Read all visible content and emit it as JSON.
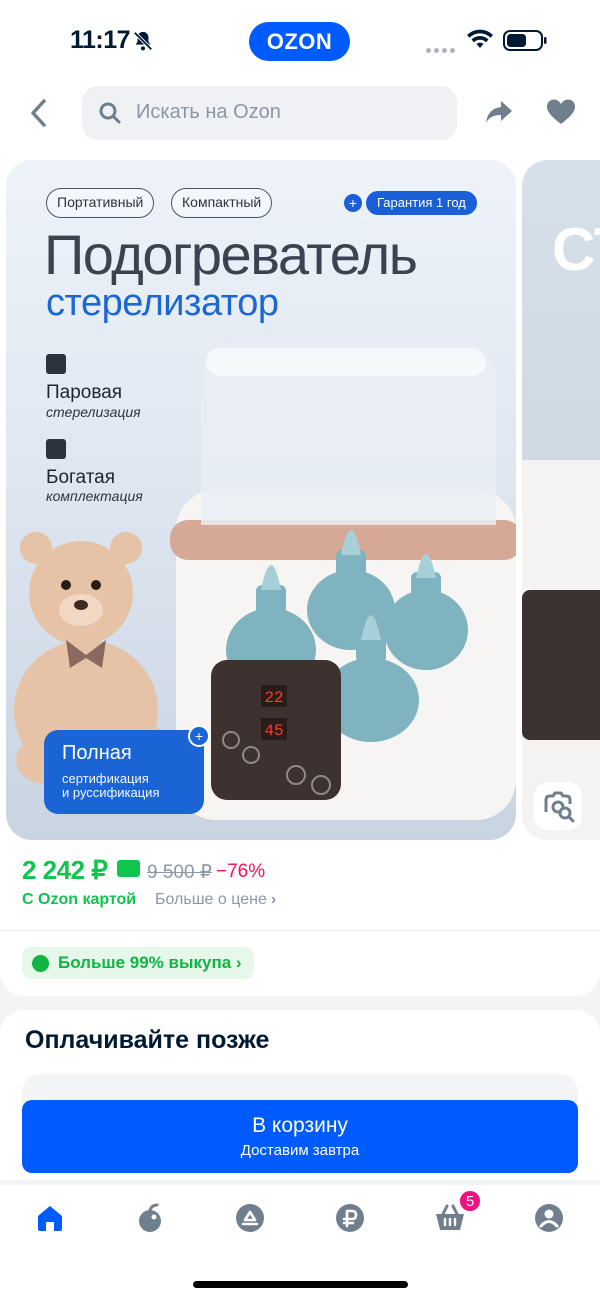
{
  "status_bar": {
    "time": "11:17"
  },
  "header": {
    "logo": "OZON",
    "search_placeholder": "Искать на Ozon"
  },
  "product_image": {
    "chips": [
      "Портативный",
      "Компактный"
    ],
    "guarantee": "Гарантия 1 год",
    "headline": "Подогреватель",
    "subheadline": "стерелизатор",
    "features": [
      {
        "title": "Паровая",
        "subtitle": "стерелизация"
      },
      {
        "title": "Богатая",
        "subtitle": "комплектация"
      }
    ],
    "badge": {
      "title": "Полная",
      "subtitle": "сертификация\nи руссификация"
    },
    "display_values": [
      "22",
      "45"
    ]
  },
  "price": {
    "current": "2 242 ₽",
    "old": "9 500 ₽",
    "discount": "−76%",
    "ozon_card_label": "С Ozon картой",
    "more_label": "Больше о цене",
    "buyout_label": "Больше 99% выкупа"
  },
  "pay_later": {
    "title": "Оплачивайте позже"
  },
  "cart_button": {
    "label": "В корзину",
    "sublabel": "Доставим завтра"
  },
  "tabbar": {
    "cart_count": "5"
  },
  "colors": {
    "brand": "#005bff",
    "price": "#10c44c",
    "discount": "#f91155",
    "badge": "#f1117e"
  },
  "icons": [
    "bell-slash-icon",
    "wifi-icon",
    "battery-icon",
    "back-icon",
    "search-icon",
    "share-icon",
    "heart-icon",
    "lens-search-icon",
    "home-icon",
    "fresh-icon",
    "catalog-icon",
    "finance-icon",
    "cart-icon",
    "profile-icon"
  ]
}
